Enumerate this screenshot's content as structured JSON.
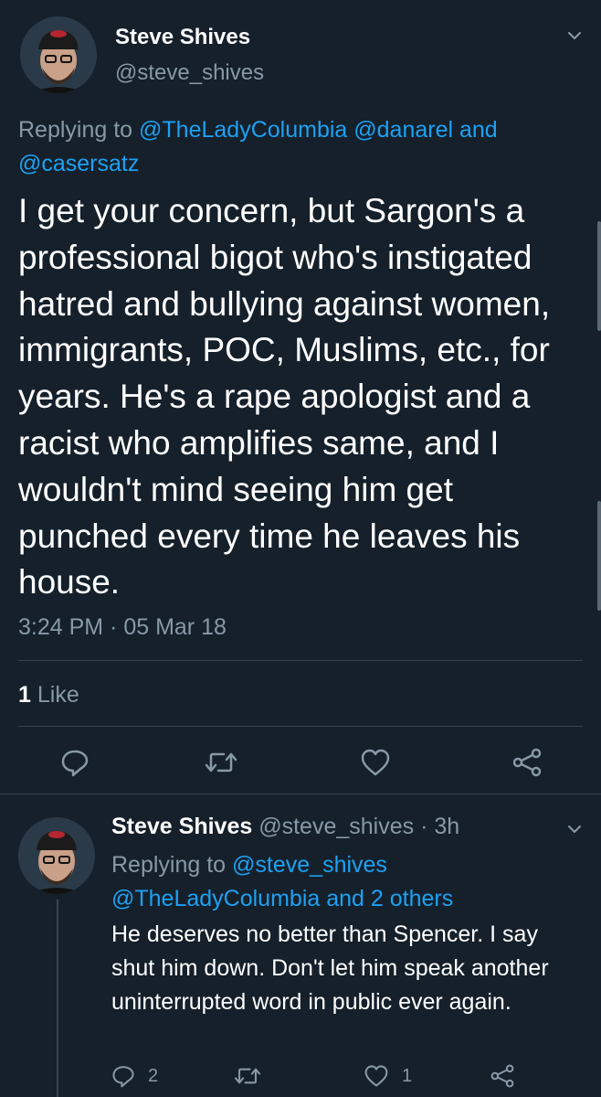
{
  "main_tweet": {
    "display_name": "Steve Shives",
    "handle": "@steve_shives",
    "replying_prefix": "Replying to",
    "replying_mentions": [
      "@TheLadyColumbia",
      "@danarel",
      "@casersatz"
    ],
    "replying_joiner": "and",
    "text": "I get your concern, but Sargon's a professional bigot who's instigated hatred and bullying against women, immigrants, POC, Muslims, etc., for years. He's a rape apologist and a racist who amplifies same, and I wouldn't mind seeing him get punched every time he leaves his house.",
    "timestamp": "3:24 PM · 05 Mar 18",
    "likes_count": "1",
    "likes_label": "Like"
  },
  "reply_tweet": {
    "display_name": "Steve Shives",
    "handle": "@steve_shives",
    "time_ago": "· 3h",
    "replying_prefix": "Replying to",
    "replying_mention": "@steve_shives",
    "replying_line2": "@TheLadyColumbia and 2 others",
    "text": "He deserves no better than Spencer. I say shut him down. Don't let him speak another uninterrupted word in public ever again.",
    "reply_count": "2",
    "like_count": "1"
  },
  "icons": {
    "menu": "chevron-down-icon",
    "reply": "reply-icon",
    "retweet": "retweet-icon",
    "like": "heart-icon",
    "share": "share-icon"
  },
  "colors": {
    "background": "#15202b",
    "link": "#1da1f2",
    "muted": "#8899a6",
    "divider": "#38444d"
  }
}
